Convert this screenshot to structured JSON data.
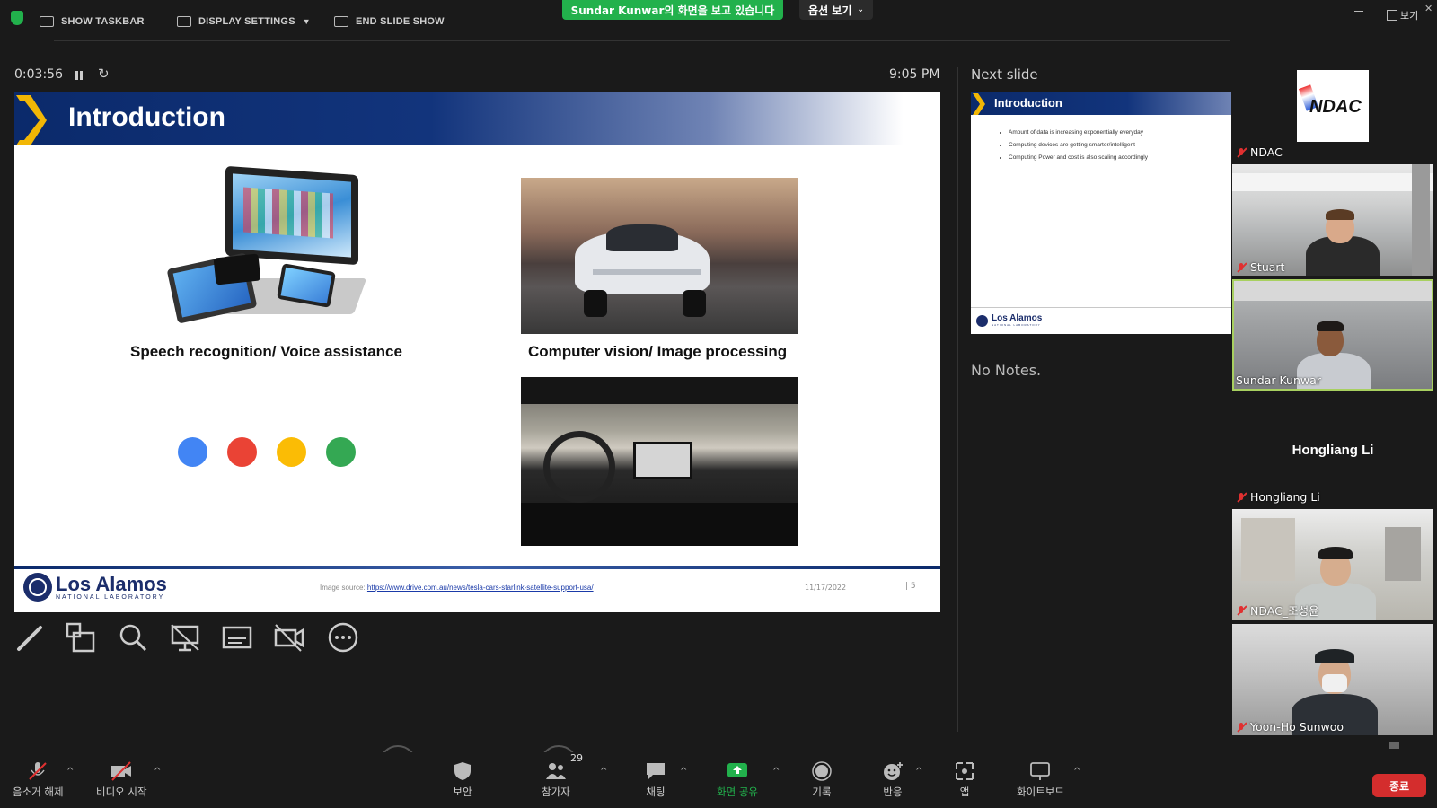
{
  "topbar": {
    "show_taskbar": "SHOW TASKBAR",
    "display_settings": "DISPLAY SETTINGS",
    "end_slide_show": "END SLIDE SHOW",
    "share_banner": "Sundar  Kunwar의 화면을 보고 있습니다",
    "view_options": "옵션 보기",
    "view_label": "보기",
    "share_color": "#22b14c"
  },
  "presenter": {
    "timer": "0:03:56",
    "clock": "9:05 PM",
    "next_slide_label": "Next slide",
    "notes": "No Notes."
  },
  "slide": {
    "title": "Introduction",
    "captions": {
      "speech": "Speech recognition/ Voice assistance",
      "vision": "Computer vision/ Image processing"
    },
    "dot_colors": [
      "#4285f4",
      "#ea4335",
      "#fbbc05",
      "#34a853"
    ],
    "logo_name": "Los Alamos",
    "logo_sub": "NATIONAL LABORATORY",
    "image_source_prefix": "Image source: ",
    "image_source_url": "https://www.drive.com.au/news/tesla-cars-starlink-satellite-support-usa/",
    "date": "11/17/2022",
    "page": "| 5"
  },
  "next_slide": {
    "title": "Introduction",
    "bullets": [
      "Amount of data is increasing exponentially everyday",
      "Computing devices are getting smarter/intelligent",
      "Computing Power and cost is also scaling accordingly"
    ],
    "logo_name": "Los Alamos",
    "logo_sub": "NATIONAL LABORATORY"
  },
  "gallery": {
    "ndac_logo_text": "NDAC",
    "participants": [
      {
        "name": "NDAC"
      },
      {
        "name": "Stuart"
      },
      {
        "name": "Sundar Kunwar"
      },
      {
        "name": "Hongliang Li",
        "display_big": "Hongliang Li"
      },
      {
        "name": "NDAC_조성윤"
      },
      {
        "name": "Yoon-Ho Sunwoo"
      }
    ]
  },
  "toolbar": {
    "unmute": "음소거 해제",
    "start_video": "비디오 시작",
    "security": "보안",
    "participants": "참가자",
    "participants_count": "29",
    "chat": "채팅",
    "share_screen": "화면 공유",
    "record": "기록",
    "reactions": "반응",
    "apps": "앱",
    "whiteboard": "화이트보드",
    "end": "종료",
    "share_color": "#22b14c",
    "end_color": "#d42d2d"
  }
}
